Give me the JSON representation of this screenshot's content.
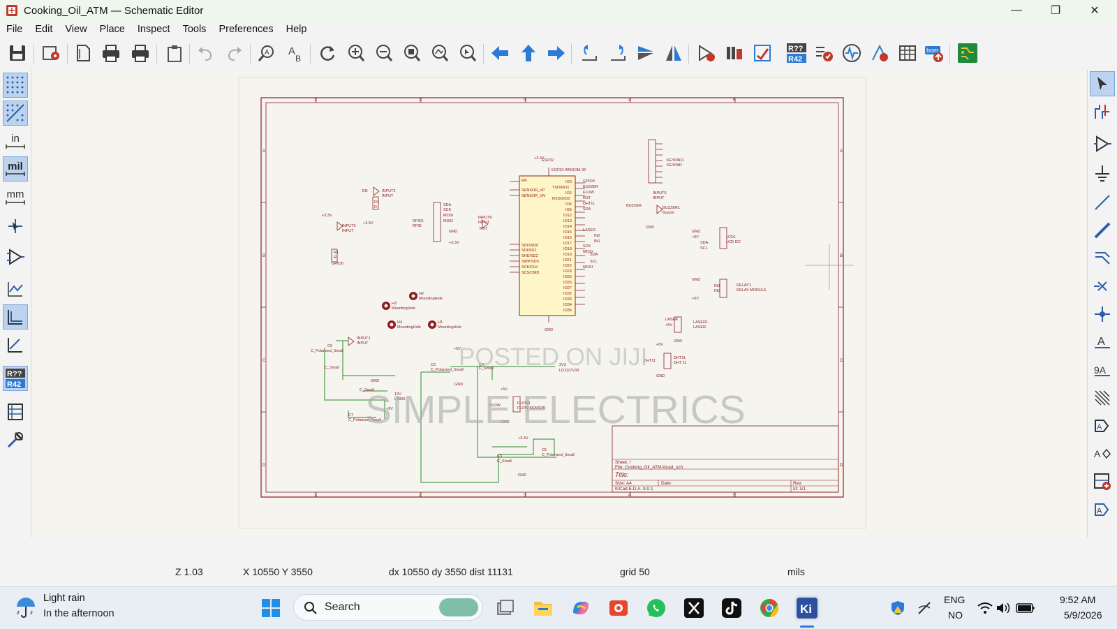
{
  "window": {
    "title": "Cooking_Oil_ATM — Schematic Editor",
    "controls": {
      "minimize": "—",
      "maximize": "❐",
      "close": "✕"
    }
  },
  "menu": [
    "File",
    "Edit",
    "View",
    "Place",
    "Inspect",
    "Tools",
    "Preferences",
    "Help"
  ],
  "toolbar_icons": [
    "save-icon",
    "schematic-setup-icon",
    "page-settings-icon",
    "print-icon",
    "plot-icon",
    "paste-icon",
    "undo-icon",
    "redo-icon",
    "find-icon",
    "find-replace-icon",
    "refresh-icon",
    "zoom-in-icon",
    "zoom-out-icon",
    "zoom-fit-icon",
    "zoom-objects-icon",
    "zoom-selection-icon",
    "navigate-back-icon",
    "navigate-up-icon",
    "navigate-forward-icon",
    "rotate-ccw-icon",
    "rotate-cw-icon",
    "mirror-vertical-icon",
    "mirror-horizontal-icon",
    "symbol-editor-icon",
    "symbol-browser-icon",
    "footprint-assign-icon",
    "annotate-icon",
    "erc-icon",
    "simulator-icon",
    "field-editor-icon",
    "bom-table-icon",
    "bom-generate-icon",
    "pcb-editor-icon"
  ],
  "left_tools": [
    "grid-dots-icon",
    "grid-overrides-icon",
    "units-inches-icon",
    "units-mils-icon",
    "units-mm-icon",
    "cursor-cross-icon",
    "hidden-pins-icon",
    "line-mode-free-icon",
    "line-mode-90-icon",
    "line-mode-45-icon",
    "annotation-icon",
    "hierarchy-navigator-icon",
    "properties-icon"
  ],
  "left_labels": {
    "in": "in",
    "mil": "mil",
    "mm": "mm",
    "annot1": "R??",
    "annot2": "R42"
  },
  "right_tools": [
    "select-icon",
    "symbol-place-icon",
    "power-port-icon",
    "ground-icon",
    "wire-icon",
    "bus-icon",
    "bus-entry-icon",
    "no-connect-icon",
    "junction-icon",
    "net-label-icon",
    "global-label-icon",
    "hierarchical-label-icon",
    "text-icon",
    "sheet-icon",
    "image-icon",
    "pin-icon"
  ],
  "schematic": {
    "watermark1": "POSTED ON JIJI",
    "watermark2": "SIMPLE ELECTRICS",
    "labels": {
      "u1_ref": "ESP32",
      "u1_val": "ESP32-WROOM-32",
      "u1_pwr": "+3.3V",
      "u1_gnd": "GND",
      "en": "EN",
      "input2": "INPUT2",
      "input": "INPUT",
      "r2": "R2",
      "r": "R",
      "v33": "+3.3V",
      "input3": "INPUT3",
      "r1": "R1",
      "gpio0": "GPIO0",
      "rfid1": "RFID1",
      "rfid": "RFID",
      "input6": "INPUT6",
      "rst": "RST",
      "sda": "SDA",
      "sck": "SCK",
      "mosi": "MOSI",
      "miso": "MISO",
      "gnd": "GND",
      "keypad1": "KEYPAD1",
      "keypad": "KEYPAD",
      "input5": "INPUT5",
      "buzzer": "BUZZER",
      "buzzer1": "BUZZER1",
      "buzzer_val": "Buzzer",
      "lcd1": "LCD1",
      "lcd_val": "LCD I2C",
      "v5": "+5V",
      "scl": "SCL",
      "relay1": "RELAY1",
      "relay_val": "RELAY MODULE",
      "in1": "IN1",
      "in2": "IN2",
      "laser1": "LASER1",
      "laser": "LASER",
      "dht11": "DHT11",
      "dht_val": "DHT 11",
      "h1": "H1",
      "h2": "H2",
      "h3": "H3",
      "h4": "H4",
      "mh": "MountingHole",
      "input1": "INPUT1",
      "c6": "C6",
      "cpol": "C_Polarized_Small",
      "csmall": "C_Small",
      "c7": "C7",
      "c2": "C2",
      "c4": "C4",
      "c3": "C3",
      "c5": "C5",
      "v12": "12V",
      "l7805": "L7805",
      "ld": "LD1117V33",
      "u3": "3V3",
      "flow1": "FLOW1",
      "flow_val": "FLOW SENSOR",
      "flow": "FLOW"
    },
    "pins_left": [
      "EN",
      "SENSOR_VP",
      "SENSOR_VN",
      "SDO/SD0",
      "SDI/SD1",
      "SHD/SD2",
      "SWP/SD3",
      "SCK/CLK",
      "SCS/CMD"
    ],
    "pins_right": [
      "IO0",
      "TXD0/IO1",
      "IO2",
      "RXD0/IO3",
      "IO4",
      "IO5",
      "IO12",
      "IO13",
      "IO14",
      "IO15",
      "IO16",
      "IO17",
      "IO18",
      "IO19",
      "IO21",
      "IO22",
      "IO23",
      "IO25",
      "IO26",
      "IO27",
      "IO32",
      "IO33",
      "IO34",
      "IO35"
    ],
    "esp_nets": [
      "GPIO0",
      "BUZZER",
      "FLOW",
      "RST",
      "DHT11",
      "SDA",
      "",
      "",
      "LASER",
      "IN2",
      "IN1",
      "SCK",
      "MISO",
      "SDA",
      "SCL",
      "MOSI"
    ],
    "title_block": {
      "sheet": "Sheet: /",
      "file": "File: Cooking_Oil_ATM.kicad_sch",
      "title": "Title:",
      "size": "Size: A4",
      "date": "Date:",
      "rev": "Rev:",
      "kicad": "KiCad E.D.A. 9.0.1",
      "id": "Id: 1/1"
    }
  },
  "status": {
    "zoom": "Z 1.03",
    "xy": "X 10550  Y 3550",
    "delta": "dx 10550  dy 3550  dist 11131",
    "grid": "grid 50",
    "units": "mils"
  },
  "taskbar": {
    "weather_line1": "Light rain",
    "weather_line2": "In the afternoon",
    "search": "Search",
    "lang1": "ENG",
    "lang2": "NO",
    "time": "9:52 AM",
    "date": "5/9/2026",
    "apps": [
      "windows-start-icon",
      "task-view-icon",
      "file-explorer-icon",
      "copilot-icon",
      "app-red-icon",
      "whatsapp-icon",
      "x-icon",
      "tiktok-icon",
      "chrome-icon",
      "kicad-icon"
    ]
  }
}
